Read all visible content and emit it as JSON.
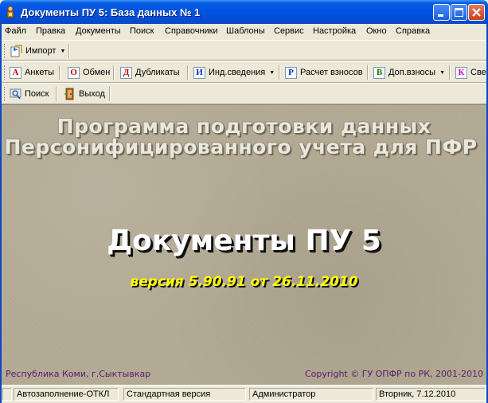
{
  "window": {
    "title": "Документы ПУ 5: База данных № 1",
    "icon": "app-person-icon"
  },
  "menu": [
    {
      "label": "Файл"
    },
    {
      "label": "Правка"
    },
    {
      "label": "Документы"
    },
    {
      "label": "Поиск"
    },
    {
      "label": "Справочники"
    },
    {
      "label": "Шаблоны"
    },
    {
      "label": "Сервис"
    },
    {
      "label": "Настройка"
    },
    {
      "label": "Окно"
    },
    {
      "label": "Справка"
    }
  ],
  "toolbar1": {
    "import_label": "Импорт",
    "import_icon": "import-icon"
  },
  "toolbar2": [
    {
      "label": "Анкеты",
      "letter": "А",
      "color": "#C00000"
    },
    {
      "label": "Обмен",
      "letter": "О",
      "color": "#C00000"
    },
    {
      "label": "Дубликаты",
      "letter": "Д",
      "color": "#C00000"
    },
    {
      "label": "Инд.сведения",
      "letter": "И",
      "color": "#0030C0"
    },
    {
      "label": "Расчет взносов",
      "letter": "Р",
      "color": "#0030C0"
    },
    {
      "label": "Доп.взносы",
      "letter": "В",
      "color": "#008000"
    },
    {
      "label": "Све",
      "letter": "К",
      "color": "#C000C0"
    }
  ],
  "toolbar3": {
    "search_label": "Поиск",
    "exit_label": "Выход"
  },
  "main": {
    "heading_line1": "Программа подготовки данных",
    "heading_line2": "Персонифицированного учета для ПФР",
    "product": "Документы ПУ 5",
    "version": "версия 5.90.91 от 26.11.2010",
    "footer_left": "Республика Коми, г.Сыктывкар",
    "footer_right": "Copyright © ГУ ОПФР по РК, 2001-2010"
  },
  "status": {
    "autofill": "Автозаполнение-ОТКЛ",
    "edition": "Стандартная версия",
    "user": "Администратор",
    "date": "Вторник,  7.12.2010"
  },
  "colors": {
    "titlebar": "#0054E3",
    "background": "#B4AB95",
    "version_text": "#FFFF00",
    "footer_text": "#5A1A6A"
  }
}
